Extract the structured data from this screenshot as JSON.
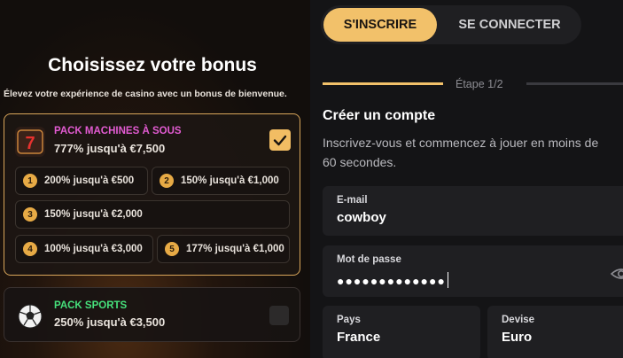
{
  "bonus": {
    "title": "Choisissez votre bonus",
    "subtitle": "Élevez votre expérience de casino avec un bonus de bienvenue.",
    "slots_pack": {
      "label": "PACK MACHINES À SOUS",
      "amount": "777% jusqu'à €7,500",
      "selected": true,
      "tiers": [
        {
          "num": "1",
          "text": "200% jusqu'à €500"
        },
        {
          "num": "2",
          "text": "150% jusqu'à €1,000"
        },
        {
          "num": "3",
          "text": "150% jusqu'à €2,000"
        },
        {
          "num": "4",
          "text": "100% jusqu'à €3,000"
        },
        {
          "num": "5",
          "text": "177% jusqu'à €1,000"
        }
      ]
    },
    "sports_pack": {
      "label": "PACK SPORTS",
      "amount": "250% jusqu'à €3,500",
      "selected": false
    }
  },
  "auth_tabs": {
    "signup": "S'INSCRIRE",
    "login": "SE CONNECTER",
    "active": "signup"
  },
  "progress": {
    "step_text": "Étape 1/2",
    "fraction": 0.5
  },
  "form": {
    "title": "Créer un compte",
    "subtitle": "Inscrivez-vous et commencez à jouer en moins de\n60 secondes.",
    "email": {
      "label": "E-mail",
      "value": "cowboy"
    },
    "password": {
      "label": "Mot de passe",
      "value": "●●●●●●●●●●●●●"
    },
    "country": {
      "label": "Pays",
      "value": "France"
    },
    "currency": {
      "label": "Devise",
      "value": "Euro"
    }
  },
  "colors": {
    "accent": "#f2c16a",
    "slots_label": "#e25bd2",
    "sports_label": "#46e07b",
    "card_border": "#d9a65a"
  }
}
